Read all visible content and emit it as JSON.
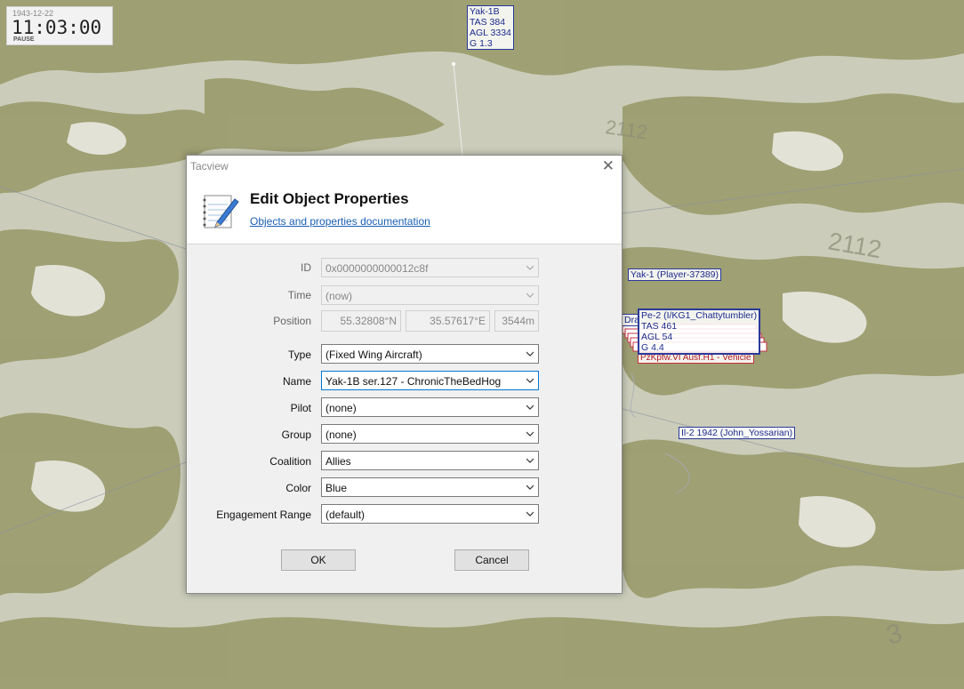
{
  "clock": {
    "date": "1943-12-22",
    "time": "11:03:00",
    "state": "PAUSE"
  },
  "map_labels": {
    "yak1b": [
      "Yak-1B",
      "TAS 384",
      "AGL 3334",
      "G 1.3"
    ],
    "yak1_player": "Yak-1 (Player-37389)",
    "dra": "Dra",
    "pe2": [
      "Pe-2 (I/KG1_Chattytumbler)",
      "TAS 461",
      "AGL 54",
      "G 4.4"
    ],
    "pzkpfw": "PzKpfw.VI Ausf.H1 - Vehicle",
    "il2": "Il-2 1942 (John_Yossarian)"
  },
  "dialog": {
    "window_title": "Tacview",
    "heading": "Edit Object Properties",
    "doc_link": "Objects and properties documentation",
    "fields": {
      "id": {
        "label": "ID",
        "value": "0x0000000000012c8f"
      },
      "time": {
        "label": "Time",
        "value": "(now)"
      },
      "position": {
        "label": "Position",
        "lat": "55.32808°N",
        "lon": "35.57617°E",
        "alt": "3544m"
      },
      "type": {
        "label": "Type",
        "value": "(Fixed Wing Aircraft)"
      },
      "name": {
        "label": "Name",
        "value": "Yak-1B ser.127 - ChronicTheBedHog"
      },
      "pilot": {
        "label": "Pilot",
        "value": "(none)"
      },
      "group": {
        "label": "Group",
        "value": "(none)"
      },
      "coalition": {
        "label": "Coalition",
        "value": "Allies"
      },
      "color": {
        "label": "Color",
        "value": "Blue"
      },
      "engagement": {
        "label": "Engagement Range",
        "value": "(default)"
      }
    },
    "ok_label": "OK",
    "cancel_label": "Cancel"
  },
  "colors": {
    "map_land": "#c9cbb6",
    "map_forest": "#9a9b6c",
    "label_blue": "#1b2a8c",
    "annotation_red": "#c8141e"
  },
  "icons": {
    "close": "close-icon",
    "app": "notepad-pen-icon",
    "dropdown": "chevron-down-icon"
  }
}
